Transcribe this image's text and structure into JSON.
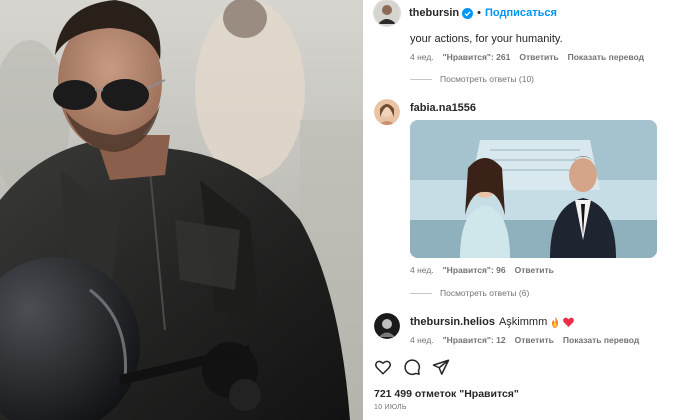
{
  "header": {
    "username": "thebursin",
    "separator": "•",
    "follow_label": "Подписаться"
  },
  "comments": [
    {
      "text": "your actions, for your humanity.",
      "time": "4 нед.",
      "likes": "\"Нравится\": 261",
      "reply_label": "Ответить",
      "translate_label": "Показать перевод",
      "view_replies": "Посмотреть ответы (10)"
    },
    {
      "username": "fabia.na1556",
      "time": "4 нед.",
      "likes": "\"Нравится\": 96",
      "reply_label": "Ответить",
      "view_replies": "Посмотреть ответы (6)"
    },
    {
      "username": "thebursin.helios",
      "text": "Aşkimmm",
      "time": "4 нед.",
      "likes": "\"Нравится\": 12",
      "reply_label": "Ответить",
      "translate_label": "Показать перевод"
    }
  ],
  "footer": {
    "likes_count": "721 499 отметок \"Нравится\"",
    "date": "10 ИЮЛЬ"
  },
  "icons": {
    "like": "heart-icon",
    "comment": "comment-icon",
    "share": "share-icon",
    "verified": "verified-badge-icon",
    "fire": "fire-icon",
    "heart_emoji": "red-heart-icon"
  },
  "colors": {
    "accent": "#0095f6",
    "text": "#262626",
    "muted": "#737373"
  }
}
